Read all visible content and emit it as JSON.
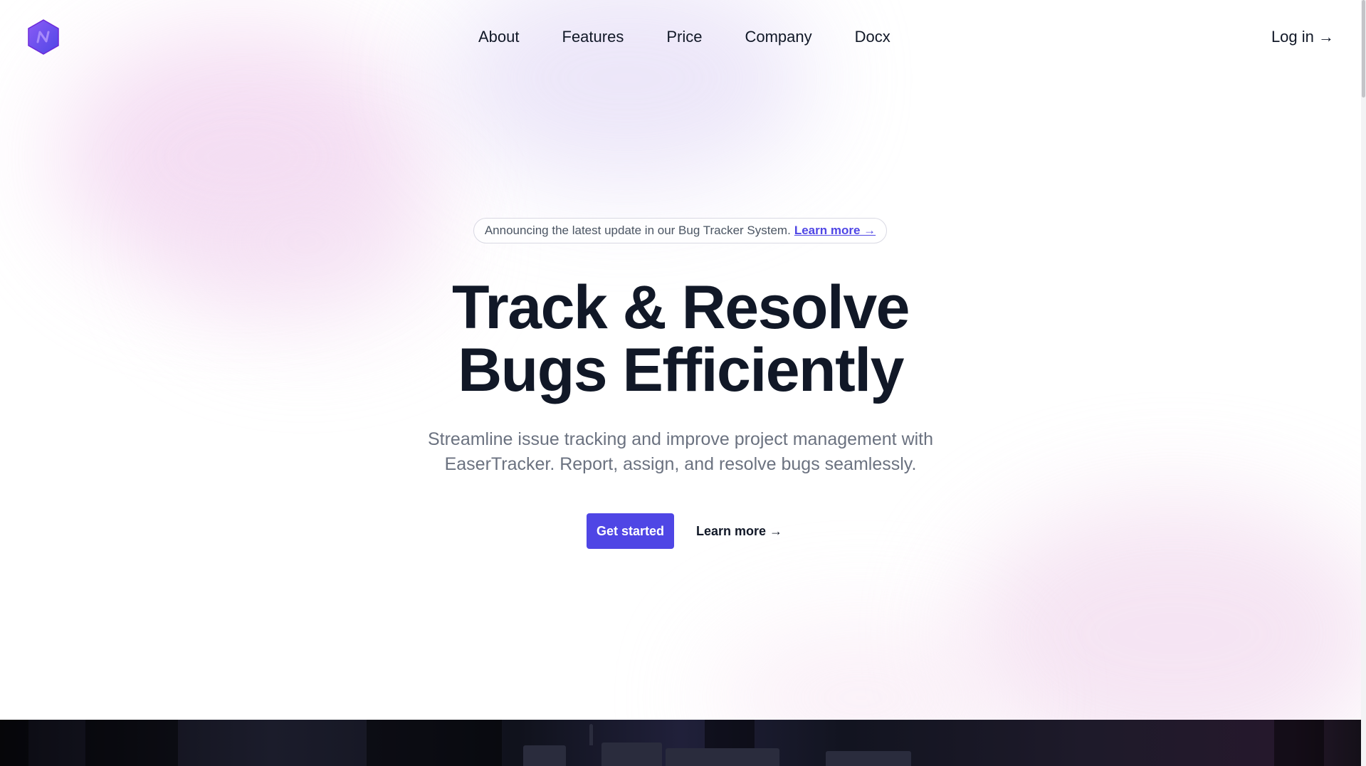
{
  "header": {
    "logo_icon": "hexagon-logo-icon",
    "nav": [
      {
        "label": "About"
      },
      {
        "label": "Features"
      },
      {
        "label": "Price"
      },
      {
        "label": "Company"
      },
      {
        "label": "Docx"
      }
    ],
    "login_label": "Log in →"
  },
  "hero": {
    "announcement_text": "Announcing the latest update in our Bug Tracker System.",
    "announcement_link": "Learn more →",
    "headline_line1": "Track & Resolve",
    "headline_line2": "Bugs Efficiently",
    "subtitle_line1": "Streamline issue tracking and improve project management with",
    "subtitle_line2": "EaserTracker. Report, assign, and resolve bugs seamlessly.",
    "primary_cta": "Get started",
    "secondary_cta": "Learn more →"
  },
  "colors": {
    "accent": "#4f46e5",
    "text": "#111827",
    "muted": "#6b7280",
    "logo_gradient": [
      "#7c3aed",
      "#4f46e5"
    ]
  }
}
